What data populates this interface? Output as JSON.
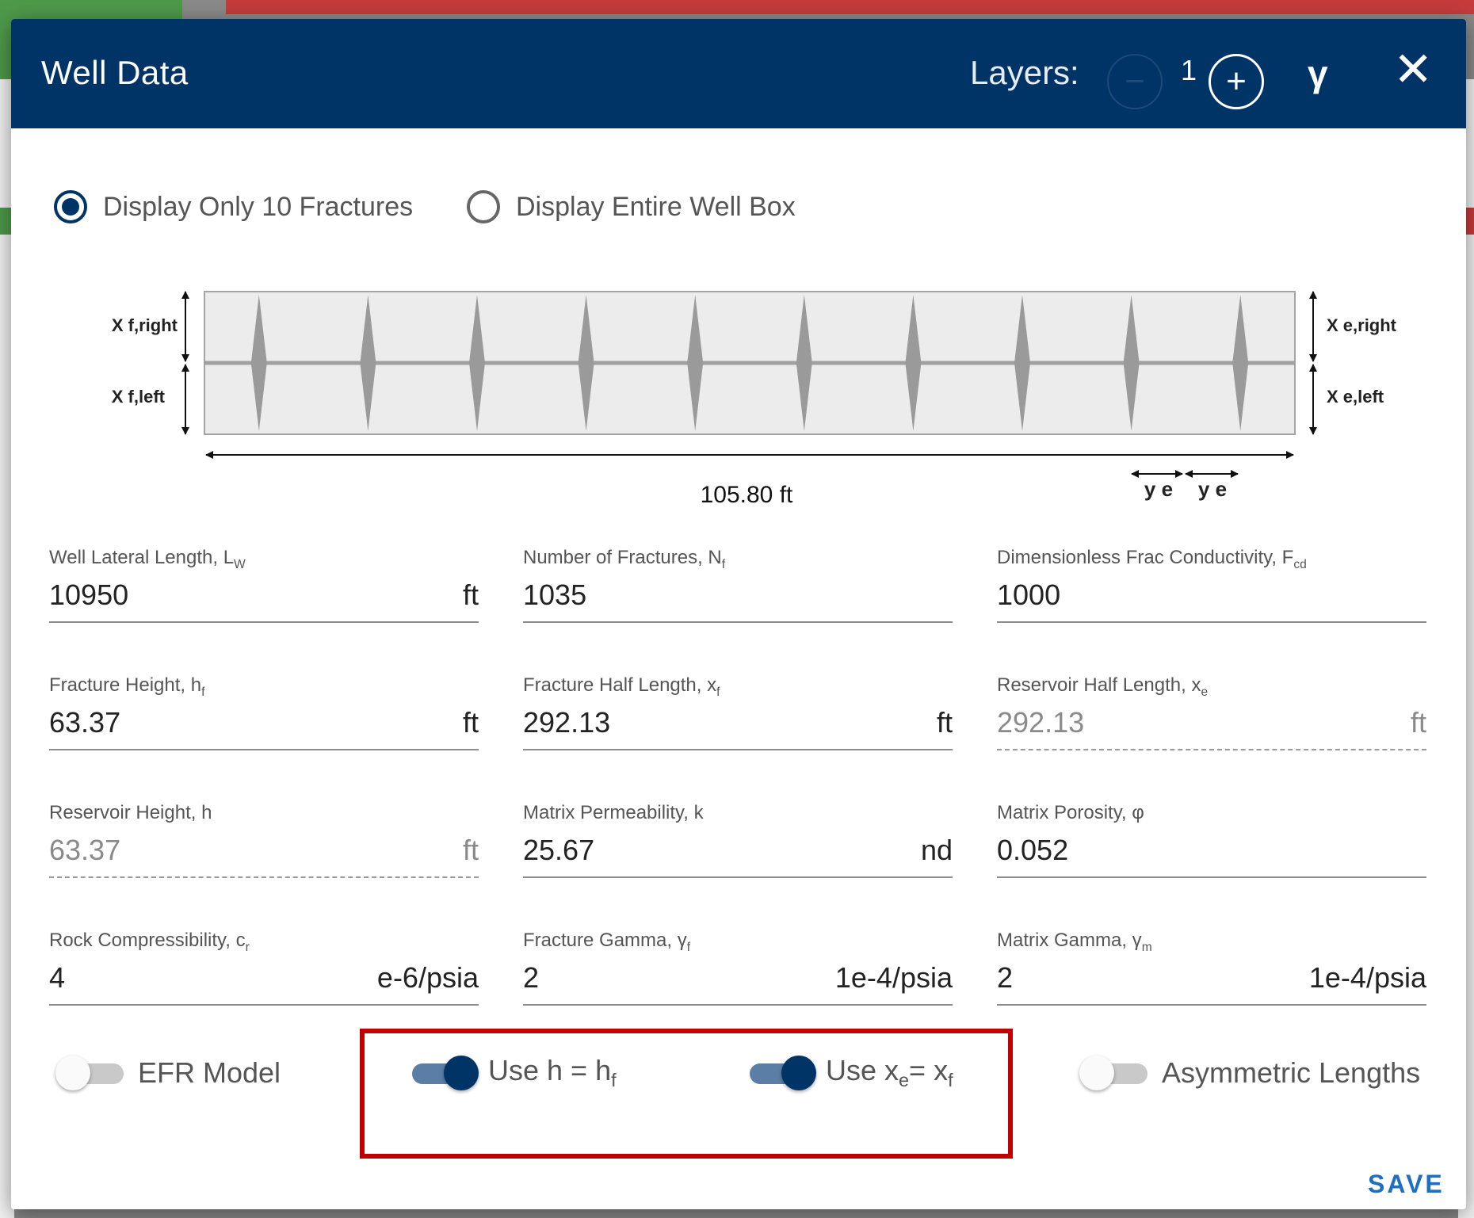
{
  "header": {
    "title": "Well Data",
    "layers_label": "Layers:",
    "minus_symbol": "−",
    "layer_count": "1",
    "plus_symbol": "+",
    "gamma_symbol": "γ",
    "close_symbol": "✕"
  },
  "display_options": [
    {
      "label": "Display Only 10 Fractures",
      "selected": true
    },
    {
      "label": "Display Entire Well Box",
      "selected": false
    }
  ],
  "diagram": {
    "fracture_count": 10,
    "label_xf_right": "X f,right",
    "label_xf_left": "X f,left",
    "label_xe_right": "X e,right",
    "label_xe_left": "X e,left",
    "length_label": "105.80 ft",
    "ye_label_1": "y e",
    "ye_label_2": "y e"
  },
  "fields": {
    "well_lateral_length": {
      "label_main": "Well Lateral Length, L",
      "label_sub": "W",
      "value": "10950",
      "unit": "ft"
    },
    "number_of_fractures": {
      "label_main": "Number of Fractures, N",
      "label_sub": "f",
      "value": "1035",
      "unit": ""
    },
    "frac_conductivity": {
      "label_main": "Dimensionless Frac Conductivity, F",
      "label_sub": "cd",
      "value": "1000",
      "unit": ""
    },
    "fracture_height": {
      "label_main": "Fracture Height, h",
      "label_sub": "f",
      "value": "63.37",
      "unit": "ft"
    },
    "fracture_half_length": {
      "label_main": "Fracture Half Length, x",
      "label_sub": "f",
      "value": "292.13",
      "unit": "ft"
    },
    "reservoir_half_length": {
      "label_main": "Reservoir Half Length, x",
      "label_sub": "e",
      "value": "292.13",
      "unit": "ft"
    },
    "reservoir_height": {
      "label_main": "Reservoir Height, h",
      "label_sub": "",
      "value": "63.37",
      "unit": "ft"
    },
    "matrix_permeability": {
      "label_main": "Matrix Permeability, k",
      "label_sub": "",
      "value": "25.67",
      "unit": "nd"
    },
    "matrix_porosity": {
      "label_main": "Matrix Porosity, φ",
      "label_sub": "",
      "value": "0.052",
      "unit": ""
    },
    "rock_compressibility": {
      "label_main": "Rock Compressibility, c",
      "label_sub": "r",
      "value": "4",
      "unit": "e-6/psia"
    },
    "fracture_gamma": {
      "label_main": "Fracture Gamma, γ",
      "label_sub": "f",
      "value": "2",
      "unit": "1e-4/psia"
    },
    "matrix_gamma": {
      "label_main": "Matrix Gamma, γ",
      "label_sub": "m",
      "value": "2",
      "unit": "1e-4/psia"
    }
  },
  "toggles": {
    "efr_model": {
      "label": "EFR Model",
      "on": false
    },
    "use_h_hf": {
      "label_main": "Use h = h",
      "label_sub": "f",
      "on": true
    },
    "use_xe_xf": {
      "label_main": "Use x",
      "label_sub_1": "e",
      "label_mid": "= x",
      "label_sub_2": "f",
      "on": true
    },
    "asymmetric_lengths": {
      "label": "Asymmetric Lengths",
      "on": false
    }
  },
  "colors": {
    "header_bg": "#003366",
    "toggle_on_knob": "#003366",
    "toggle_on_track": "#5a7ea6",
    "highlight": "#c00000",
    "save": "#1e6fc0"
  },
  "save_label": "SAVE"
}
